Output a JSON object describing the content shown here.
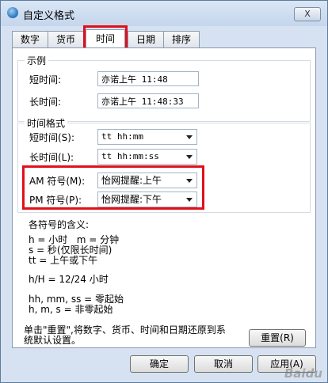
{
  "window": {
    "title": "自定义格式",
    "close_label": "X"
  },
  "tabs": [
    "数字",
    "货币",
    "时间",
    "日期",
    "排序"
  ],
  "active_tab": "时间",
  "example": {
    "title": "示例",
    "short_label": "短时间:",
    "short_value": "亦诺上午 11:48",
    "long_label": "长时间:",
    "long_value": "亦诺上午 11:48:33"
  },
  "time_format": {
    "title": "时间格式",
    "short_label": "短时间(S):",
    "short_value": "tt hh:mm",
    "long_label": "长时间(L):",
    "long_value": "tt hh:mm:ss",
    "am_label": "AM 符号(M):",
    "am_value": "怡网提醒:上午",
    "pm_label": "PM 符号(P):",
    "pm_value": "怡网提醒:下午"
  },
  "help": {
    "title": "各符号的含义:",
    "line1": "h = 小时   m = 分钟",
    "line2": "s = 秒(仅限长时间)",
    "line3": "tt = 上午或下午",
    "line4": "h/H = 12/24 小时",
    "line5": "hh, mm, ss = 零起始",
    "line6": "h, m, s = 非零起始"
  },
  "reset_text_line1": "单击\"重置\",将数字、货币、时间和日期还原到系",
  "reset_text_line2": "统默认设置。",
  "buttons": {
    "reset": "重置(R)",
    "ok": "确定",
    "cancel": "取消",
    "apply": "应用(A)"
  },
  "watermark": "Baidu",
  "colors": {
    "highlight": "#e0101a"
  }
}
